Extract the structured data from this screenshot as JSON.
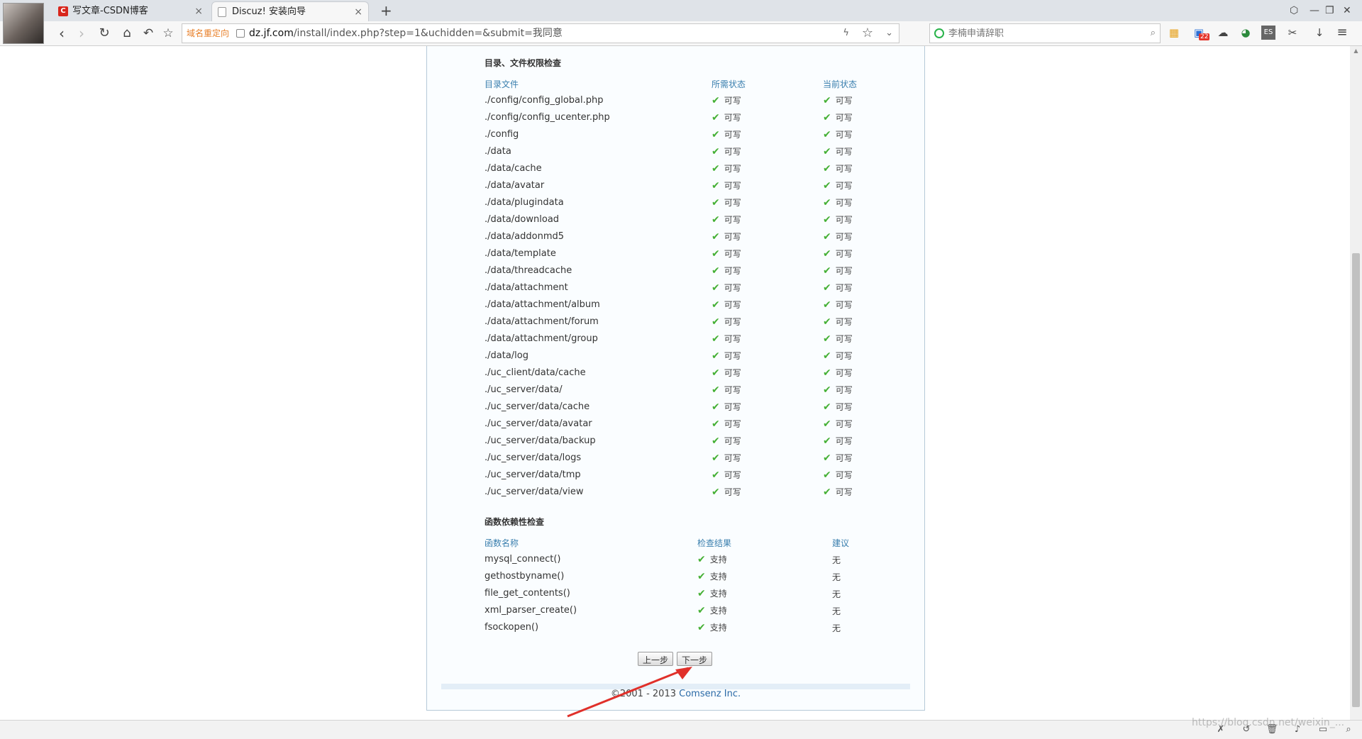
{
  "tabs": [
    {
      "title": "写文章-CSDN博客",
      "close": "×",
      "favicon_color": "#d8261c"
    },
    {
      "title": "Discuz! 安装向导",
      "close": "×"
    }
  ],
  "new_tab": "+",
  "address": {
    "redirect_label": "域名重定向",
    "host": "dz.jf.com",
    "path": "/install/index.php?step=1&uchidden=&submit=我同意"
  },
  "search": {
    "placeholder": "李楠申请辞职"
  },
  "ext_badge": "22",
  "dirs": {
    "title": "目录、文件权限检查",
    "headers": [
      "目录文件",
      "所需状态",
      "当前状态"
    ],
    "status_text": "可写",
    "rows": [
      "./config/config_global.php",
      "./config/config_ucenter.php",
      "./config",
      "./data",
      "./data/cache",
      "./data/avatar",
      "./data/plugindata",
      "./data/download",
      "./data/addonmd5",
      "./data/template",
      "./data/threadcache",
      "./data/attachment",
      "./data/attachment/album",
      "./data/attachment/forum",
      "./data/attachment/group",
      "./data/log",
      "./uc_client/data/cache",
      "./uc_server/data/",
      "./uc_server/data/cache",
      "./uc_server/data/avatar",
      "./uc_server/data/backup",
      "./uc_server/data/logs",
      "./uc_server/data/tmp",
      "./uc_server/data/view"
    ]
  },
  "funcs": {
    "title": "函数依赖性检查",
    "headers": [
      "函数名称",
      "检查结果",
      "建议"
    ],
    "result_text": "支持",
    "advice_text": "无",
    "rows": [
      "mysql_connect()",
      "gethostbyname()",
      "file_get_contents()",
      "xml_parser_create()",
      "fsockopen()"
    ]
  },
  "buttons": {
    "prev": "上一步",
    "next": "下一步"
  },
  "footer": {
    "copyright": "©2001 - 2013 ",
    "company": "Comsenz Inc."
  },
  "watermark": "https://blog.csdn.net/weixin_..."
}
